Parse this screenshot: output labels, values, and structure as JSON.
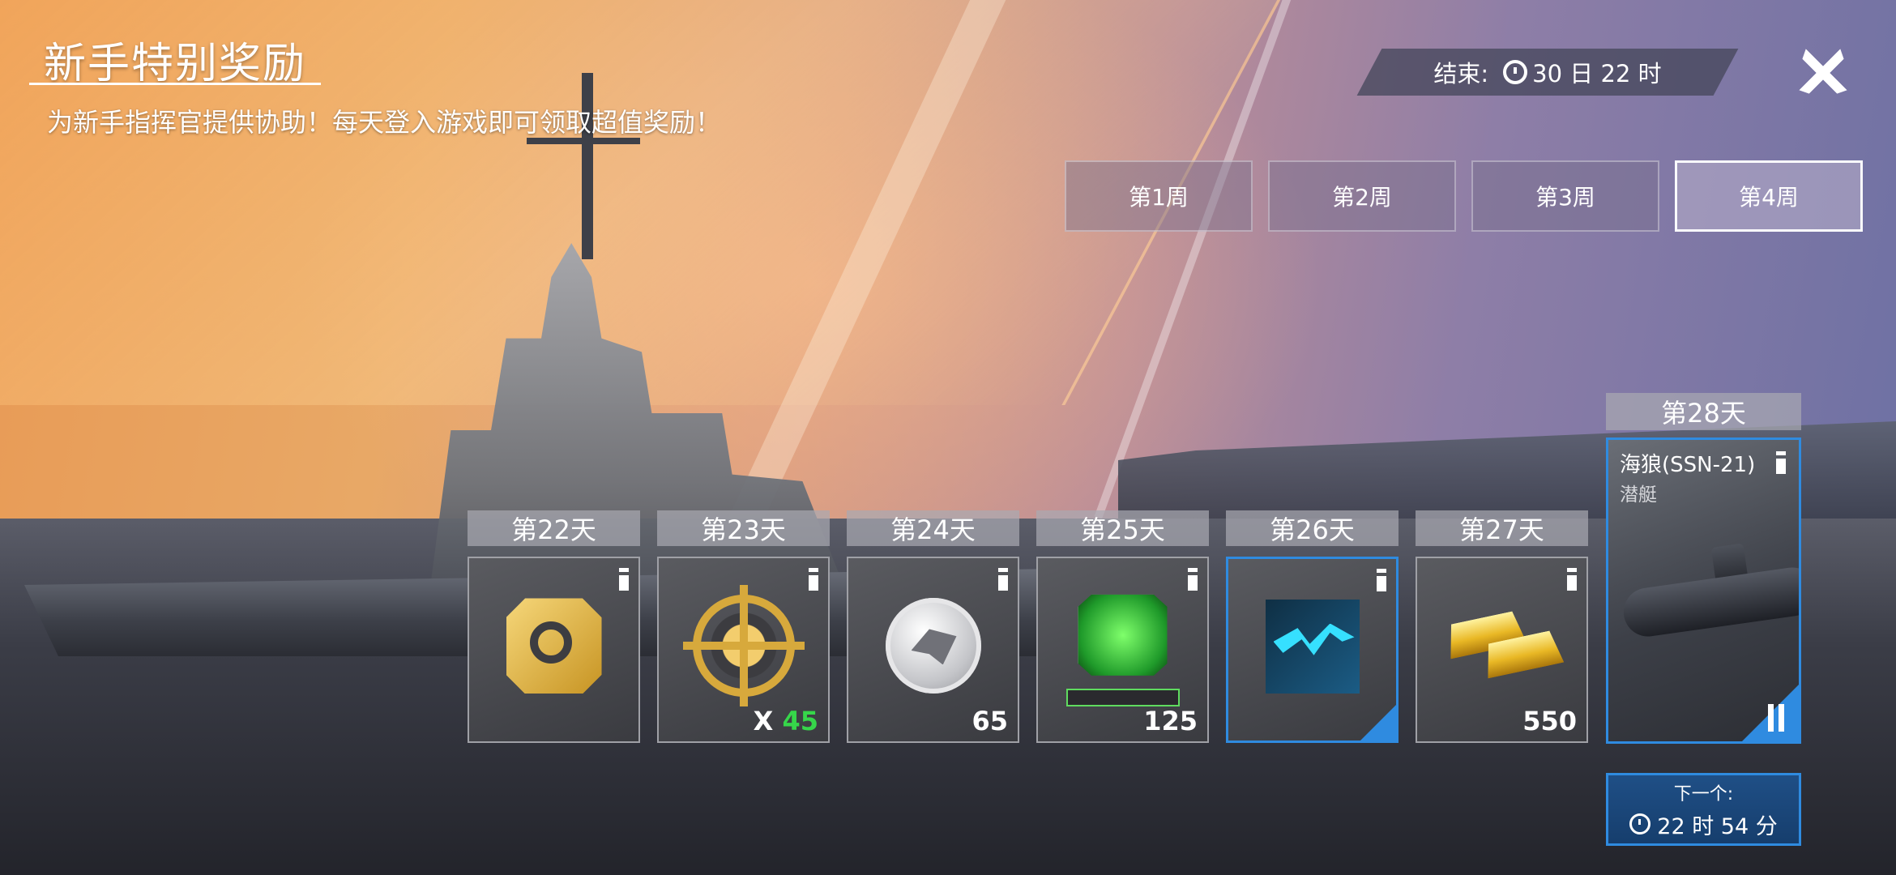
{
  "header": {
    "title": "新手特别奖励",
    "subtitle": "为新手指挥官提供协助！每天登入游戏即可领取超值奖励！",
    "timer_label": "结束:",
    "timer_value": "30 日 22 时"
  },
  "weeks": [
    "第1周",
    "第2周",
    "第3周",
    "第4周"
  ],
  "active_week": "第4周",
  "days": [
    {
      "label": "第22天",
      "icon": "gold-tool-icon",
      "qty_prefix": "",
      "qty_value": ""
    },
    {
      "label": "第23天",
      "icon": "gold-target-icon",
      "qty_prefix": "X ",
      "qty_value": "45"
    },
    {
      "label": "第24天",
      "icon": "silver-emblem-icon",
      "qty_prefix": "",
      "qty_value": "65"
    },
    {
      "label": "第25天",
      "icon": "green-chip-icon",
      "qty_prefix": "",
      "qty_value": "125"
    },
    {
      "label": "第26天",
      "icon": "lightning-camo-icon",
      "qty_prefix": "",
      "qty_value": ""
    },
    {
      "label": "第27天",
      "icon": "gold-bars-icon",
      "qty_prefix": "",
      "qty_value": "550"
    }
  ],
  "day28": {
    "label": "第28天",
    "name": "海狼(SSN-21)",
    "type": "潜艇"
  },
  "next": {
    "label": "下一个:",
    "time": "22 时 54 分"
  },
  "colors": {
    "selected_border": "#2f8be0",
    "qty_highlight": "#36d64a",
    "next_bg": "#1f4f86"
  }
}
